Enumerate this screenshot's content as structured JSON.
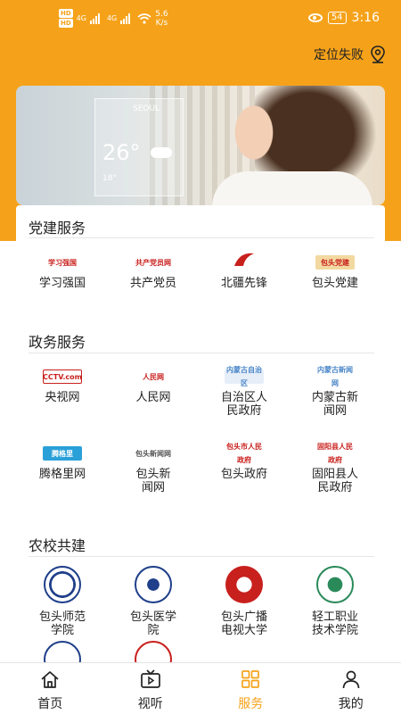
{
  "status_bar": {
    "hd1": "HD",
    "hd2": "HD",
    "net1": "4G",
    "net2": "4G",
    "speed_value": "5.6",
    "speed_unit": "K/s",
    "battery": "54",
    "time": "3:16"
  },
  "location": {
    "text": "定位失败",
    "icon": "location-pin-icon"
  },
  "banner": {
    "city": "SEOUL",
    "temperature": "26°",
    "mini": "18°"
  },
  "sections": {
    "party": {
      "title": "党建服务",
      "items": [
        {
          "label": "学习强国",
          "logo_text": "学习强国",
          "color": "#c8201d"
        },
        {
          "label": "共产党员",
          "logo_text": "共产党员网",
          "color": "#c8201d"
        },
        {
          "label": "北疆先锋",
          "logo_text": "北疆先锋",
          "color": "#c8201d"
        },
        {
          "label": "包头党建",
          "logo_text": "包头党建",
          "color": "#c8201d"
        }
      ]
    },
    "gov": {
      "title": "政务服务",
      "items": [
        {
          "label": "央视网",
          "logo_text": "CCTV.com",
          "color": "#c8201d"
        },
        {
          "label": "人民网",
          "logo_text": "人民网",
          "color": "#c8201d"
        },
        {
          "label": "自治区人民政府",
          "logo_text": "内蒙古自治区",
          "color": "#4a86c8"
        },
        {
          "label": "内蒙古新闻网",
          "logo_text": "内蒙古新闻网",
          "color": "#4a86c8"
        },
        {
          "label": "腾格里网",
          "logo_text": "腾格里",
          "color": "#2aa0d8"
        },
        {
          "label": "包头新闻网",
          "logo_text": "包头新闻网",
          "color": "#555555"
        },
        {
          "label": "包头政府",
          "logo_text": "包头市人民政府",
          "color": "#c8201d"
        },
        {
          "label": "固阳县人民政府",
          "logo_text": "固阳县人民政府",
          "color": "#c8201d"
        }
      ]
    },
    "edu": {
      "title": "农校共建",
      "items": [
        {
          "label": "包头师范学院",
          "color": "#1f3f8a"
        },
        {
          "label": "包头医学院",
          "color": "#1f3f8a"
        },
        {
          "label": "包头广播电视大学",
          "color": "#c8201d"
        },
        {
          "label": "轻工职业技术学院",
          "color": "#2a8a5a"
        },
        {
          "label": "",
          "color": "#1f3f8a"
        },
        {
          "label": "",
          "color": "#c8201d"
        }
      ]
    }
  },
  "bottom_nav": [
    {
      "label": "首页",
      "icon": "home-icon"
    },
    {
      "label": "视听",
      "icon": "video-icon"
    },
    {
      "label": "服务",
      "icon": "grid-icon",
      "active": true
    },
    {
      "label": "我的",
      "icon": "user-icon"
    }
  ],
  "colors": {
    "accent": "#f5a21a",
    "text": "#222222"
  }
}
